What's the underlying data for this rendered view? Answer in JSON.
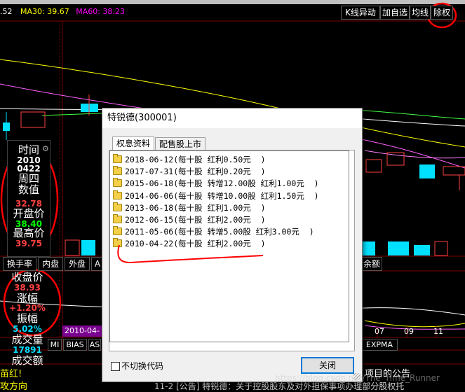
{
  "toolbar": {
    "ma_items": [
      {
        "text": ".52",
        "color": "#ffffff"
      },
      {
        "text": "MA30: 39.67",
        "color": "#ffff00"
      },
      {
        "text": "MA60: 38.23",
        "color": "#ff00ff"
      }
    ],
    "buttons": [
      "K线异动",
      "加自选",
      "均线",
      "除权"
    ]
  },
  "left_panel": {
    "time_label": "时间",
    "year": "2010",
    "date": "0422",
    "weekday": "周四",
    "value_label": "数值",
    "value": "32.78",
    "open_label": "开盘价",
    "open_value": "38.40",
    "high_label": "最高价",
    "high_value": "39.75"
  },
  "tabs": [
    "换手率",
    "内盘",
    "外盘",
    "A"
  ],
  "tab_right": "余额",
  "stats": {
    "close_label": "收盘价",
    "close_value": "38.93",
    "change_label": "涨幅",
    "change_value": "+1.20%",
    "amp_label": "振幅",
    "amp_value": "5.02%",
    "volume_label": "成交量",
    "volume_value": "17891",
    "amount_label": "成交额"
  },
  "date_marker": "2010-04-",
  "x_ticks": [
    "07",
    "09",
    "11"
  ],
  "indicators": [
    "MI",
    "BIAS",
    "AS"
  ],
  "indicator_right": "EXPMA",
  "news_left": "苗红!",
  "news_bottom": "攻方向",
  "news_bottom2": "11-2 [公告] 特锐德：关于控股股东及对外担保事项办理部分股权托",
  "news_right": "项目的公告",
  "dialog": {
    "title": "特锐德(300001)",
    "tabs": [
      {
        "label": "权息资料",
        "active": true
      },
      {
        "label": "配售股上市",
        "active": false
      }
    ],
    "rows": [
      "2018-06-12(每十股 红利0.50元  )",
      "2017-07-31(每十股 红利0.20元  )",
      "2015-06-18(每十股 转增12.00股 红利1.00元  )",
      "2014-06-06(每十股 转增10.00股 红利1.50元  )",
      "2013-06-18(每十股 红利1.00元  )",
      "2012-06-15(每十股 红利2.00元  )",
      "2011-05-06(每十股 转增5.00股 红利3.00元  )",
      "2010-04-22(每十股 红利2.00元  )"
    ],
    "checkbox_label": "不切换代码",
    "close_label": "关闭"
  },
  "watermark": "https://blog.csdn.net/The_Time_Runner",
  "colors": {
    "price_red": "#ff4040",
    "price_green": "#00ff00",
    "accent_cyan": "#00e0ff",
    "annotation_red": "#ff0000"
  }
}
